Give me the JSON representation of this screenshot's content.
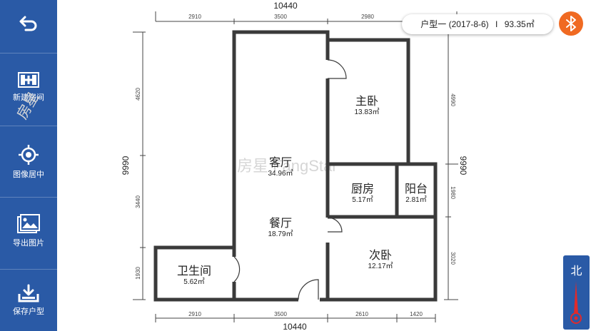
{
  "sidebar": {
    "items": [
      {
        "id": "back",
        "label": "",
        "icon": "back-arrow-icon"
      },
      {
        "id": "new-room",
        "label": "新建房间",
        "icon": "new-room-icon"
      },
      {
        "id": "center",
        "label": "图像居中",
        "icon": "crosshair-icon"
      },
      {
        "id": "export",
        "label": "导出图片",
        "icon": "image-icon"
      },
      {
        "id": "save",
        "label": "保存户型",
        "icon": "download-icon"
      }
    ]
  },
  "badge": {
    "name": "户型一",
    "date": "(2017-8-6)",
    "separator": "I",
    "area": "93.35㎡"
  },
  "bluetooth": {
    "icon": "bluetooth-icon",
    "color": "#f06a22"
  },
  "compass": {
    "label": "北",
    "icon": "compass-needle-icon"
  },
  "floorplan": {
    "top_total": "10440",
    "top_segments": [
      "2910",
      "3500",
      "2980"
    ],
    "bottom_total": "10440",
    "bottom_segments": [
      "2910",
      "3500",
      "2610",
      "1420"
    ],
    "left_total": "9990",
    "left_segments": [
      "4620",
      "3440",
      "1930"
    ],
    "right_total": "9990",
    "right_segments": [
      "4990",
      "1980",
      "3020"
    ],
    "rooms": [
      {
        "name": "客厅",
        "area": "34.96㎡"
      },
      {
        "name": "餐厅",
        "area": "18.79㎡"
      },
      {
        "name": "主卧",
        "area": "13.83㎡"
      },
      {
        "name": "厨房",
        "area": "5.17㎡"
      },
      {
        "name": "阳台",
        "area": "2.81㎡"
      },
      {
        "name": "次卧",
        "area": "12.17㎡"
      },
      {
        "name": "卫生间",
        "area": "5.62㎡"
      }
    ],
    "watermark": "房星 FangStar"
  },
  "colors": {
    "sidebar": "#2a5aa6",
    "wall": "#3a3a3a",
    "accent": "#f06a22"
  }
}
